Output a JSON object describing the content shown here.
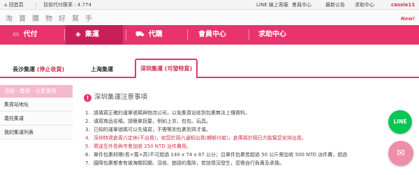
{
  "topbar": {
    "home_icon": "⌂",
    "home_label": "回首頁",
    "rate_label": "目前代付匯率 : 4.774",
    "line_service": "LINE 線上客服",
    "member_center": "會員中心",
    "announcements": "最新公告",
    "help_center": "求助中心",
    "username": "cassie11"
  },
  "brand": {
    "name": "淘寶購物好幫手",
    "new_tag": "New!"
  },
  "nav": {
    "items": [
      {
        "label": "代付",
        "icon": "credit-card-icon",
        "glyph": "▭"
      },
      {
        "label": "集運",
        "icon": "box-icon",
        "glyph": "◈"
      },
      {
        "label": "代購",
        "icon": "cart-icon",
        "glyph": "⛟"
      },
      {
        "label": "會員中心",
        "icon": "",
        "glyph": ""
      },
      {
        "label": "求助中心",
        "icon": "",
        "glyph": ""
      }
    ]
  },
  "subtabs": {
    "changsha": "長沙集運",
    "changsha_note": "(停止收貨)",
    "shanghai": "上海集運",
    "shenzhen": "深圳集運 (可發特貨)"
  },
  "sidebar": {
    "header": "流程 · 費用 · 注意事項",
    "items": [
      "集貨站地址",
      "委託集運",
      "我的集運列表"
    ]
  },
  "content": {
    "info_glyph": "!",
    "title": "深圳集運注意事項",
    "rules": [
      {
        "num": "1.",
        "text": "請填寫正確的運單號碼與物流公司，以免集貨站收到包裹無法上傳資料。"
      },
      {
        "num": "2.",
        "text": "填寫商品名稱，請簡單扼要，例如上衣、包包、玩具。"
      },
      {
        "num": "3.",
        "text": "已知的運單號碼可以先填寫，不需等到包裹到齊才填。"
      },
      {
        "num": "4.",
        "text": "深圳特貨倉周六定休(不出貨)，如您於周六通知出貨(轉帳付款)，倉庫將於隔日方能幫您安排出貨。"
      },
      {
        "num": "5.",
        "text": "寄送至外島與市會加收 250 NTD 派件費用。"
      },
      {
        "num": "6.",
        "text": "單件包裹材積(長×寬×高)不可超過 140 x 74 x 87 公分；且單件包裹若超過 50 公斤需加收 500 NTD 派件費，超過"
      },
      {
        "num": "7.",
        "text": "國際包裹都會有被海關扣關、沒收、銷毀的風險，若該情況發生，您需自行負責及承擔。"
      }
    ]
  },
  "float": {
    "line_label": "LINE",
    "mail_glyph": "✉"
  },
  "colors": {
    "brand_pink": "#e8336d",
    "active_nav": "#c81f57",
    "highlight_red": "#d0304a",
    "line_green": "#06c755"
  }
}
